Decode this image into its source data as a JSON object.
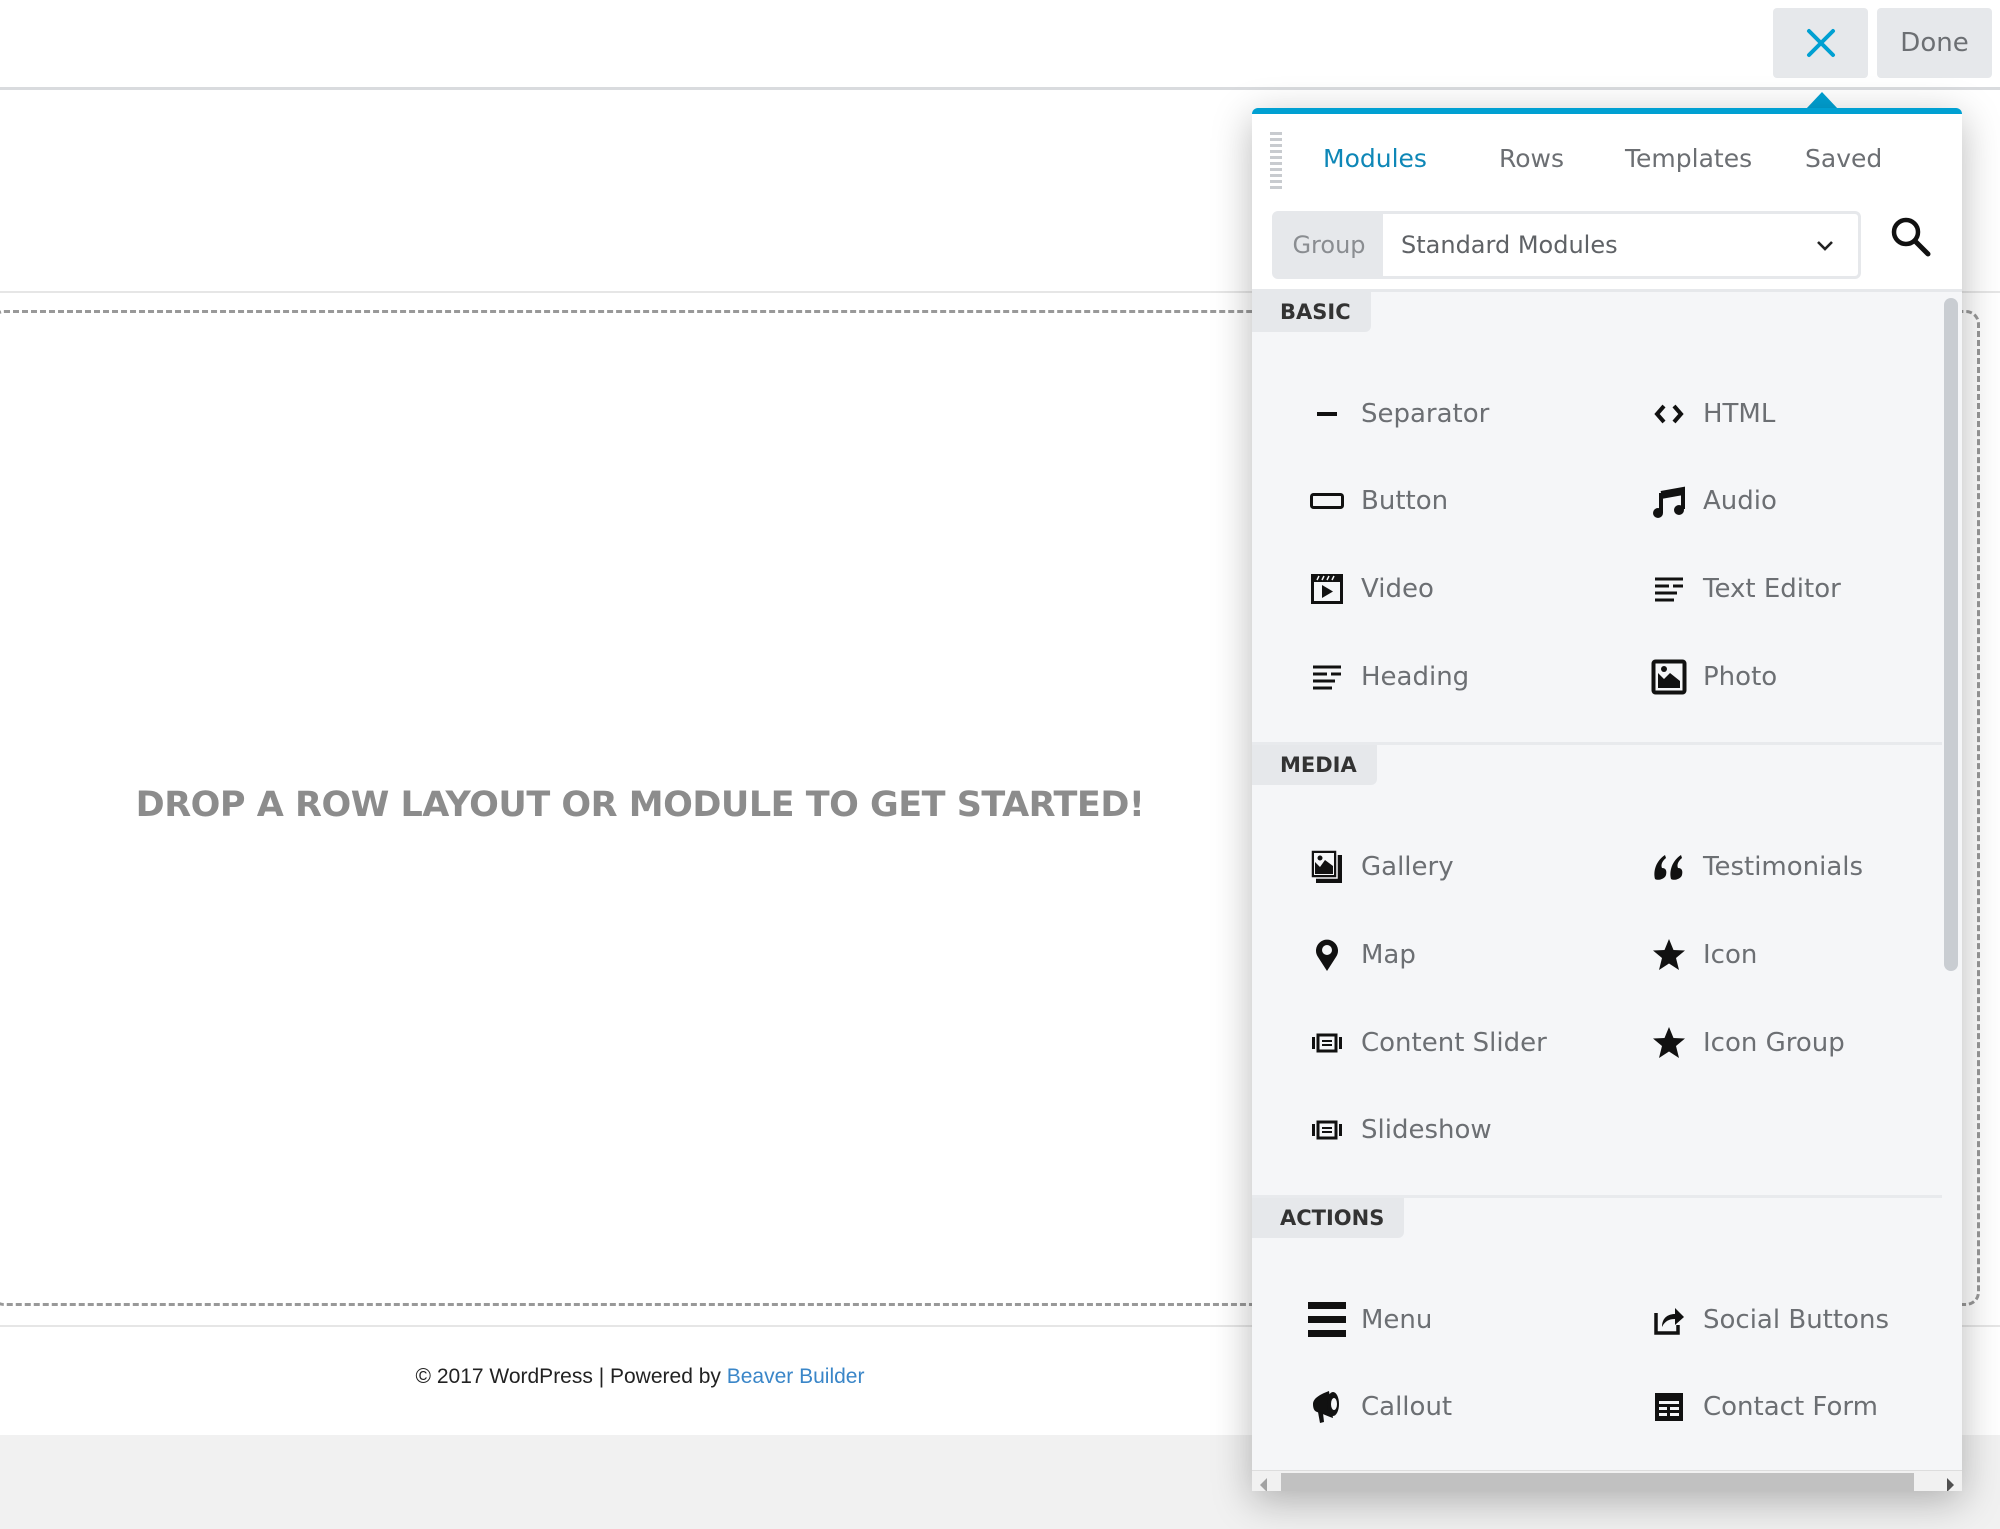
{
  "toolbar": {
    "close_icon": "close-icon",
    "done_label": "Done",
    "accent_color": "#00a0d2"
  },
  "page": {
    "drop_message": "DROP A ROW LAYOUT OR MODULE TO GET STARTED!",
    "footer_text": "© 2017 WordPress | Powered by ",
    "footer_link": "Beaver Builder"
  },
  "panel": {
    "tabs": [
      {
        "label": "Modules",
        "active": true
      },
      {
        "label": "Rows",
        "active": false
      },
      {
        "label": "Templates",
        "active": false
      },
      {
        "label": "Saved",
        "active": false
      }
    ],
    "group": {
      "label": "Group",
      "value": "Standard Modules"
    },
    "search_icon": "search-icon",
    "sections": [
      {
        "title": "BASIC",
        "items": [
          {
            "label": "Separator",
            "icon": "separator-icon"
          },
          {
            "label": "HTML",
            "icon": "code-icon"
          },
          {
            "label": "Button",
            "icon": "button-icon"
          },
          {
            "label": "Audio",
            "icon": "music-note-icon"
          },
          {
            "label": "Video",
            "icon": "video-icon"
          },
          {
            "label": "Text Editor",
            "icon": "text-editor-icon"
          },
          {
            "label": "Heading",
            "icon": "heading-icon"
          },
          {
            "label": "Photo",
            "icon": "photo-icon"
          }
        ]
      },
      {
        "title": "MEDIA",
        "items": [
          {
            "label": "Gallery",
            "icon": "gallery-icon"
          },
          {
            "label": "Testimonials",
            "icon": "quote-icon"
          },
          {
            "label": "Map",
            "icon": "map-pin-icon"
          },
          {
            "label": "Icon",
            "icon": "star-icon"
          },
          {
            "label": "Content Slider",
            "icon": "slider-icon"
          },
          {
            "label": "Icon Group",
            "icon": "star-icon"
          },
          {
            "label": "Slideshow",
            "icon": "slider-icon"
          }
        ]
      },
      {
        "title": "ACTIONS",
        "items": [
          {
            "label": "Menu",
            "icon": "menu-icon"
          },
          {
            "label": "Social Buttons",
            "icon": "share-icon"
          },
          {
            "label": "Callout",
            "icon": "megaphone-icon"
          },
          {
            "label": "Contact Form",
            "icon": "form-icon"
          }
        ]
      }
    ]
  }
}
